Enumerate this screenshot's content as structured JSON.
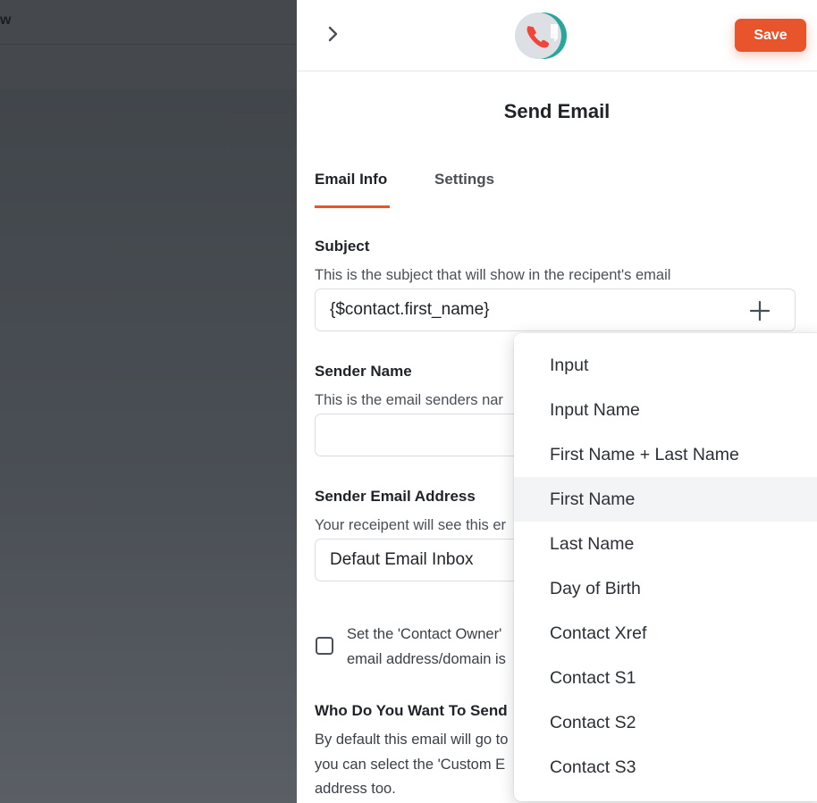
{
  "backdrop": {
    "partial_text": "w"
  },
  "header": {
    "save_label": "Save",
    "logo_icon": "phone-chat-icon",
    "back_icon": "chevron-right-icon",
    "accent": "#e8542c"
  },
  "panel": {
    "title": "Send Email",
    "tabs": [
      {
        "label": "Email Info",
        "active": true
      },
      {
        "label": "Settings",
        "active": false
      }
    ]
  },
  "form": {
    "subject": {
      "label": "Subject",
      "description": "This is the subject that will show in the recipent's email",
      "value": "{$contact.first_name}"
    },
    "sender_name": {
      "label": "Sender Name",
      "description": "This is the email senders nar",
      "value": ""
    },
    "sender_email": {
      "label": "Sender Email Address",
      "description": "Your receipent will see this er",
      "value": "Defaut Email Inbox"
    },
    "contact_owner": {
      "line1": "Set the 'Contact Owner'",
      "line2": "email address/domain is",
      "checked": false
    },
    "who_to_send": {
      "label": "Who Do You Want To Send",
      "line1": "By default this email will go to",
      "line2": "you can select the 'Custom E",
      "line3": "address too."
    }
  },
  "dropdown": {
    "items": [
      "Input",
      "Input Name",
      "First Name + Last Name",
      "First Name",
      "Last Name",
      "Day of Birth",
      "Contact Xref",
      "Contact S1",
      "Contact S2",
      "Contact S3"
    ],
    "hovered_index": 3
  }
}
